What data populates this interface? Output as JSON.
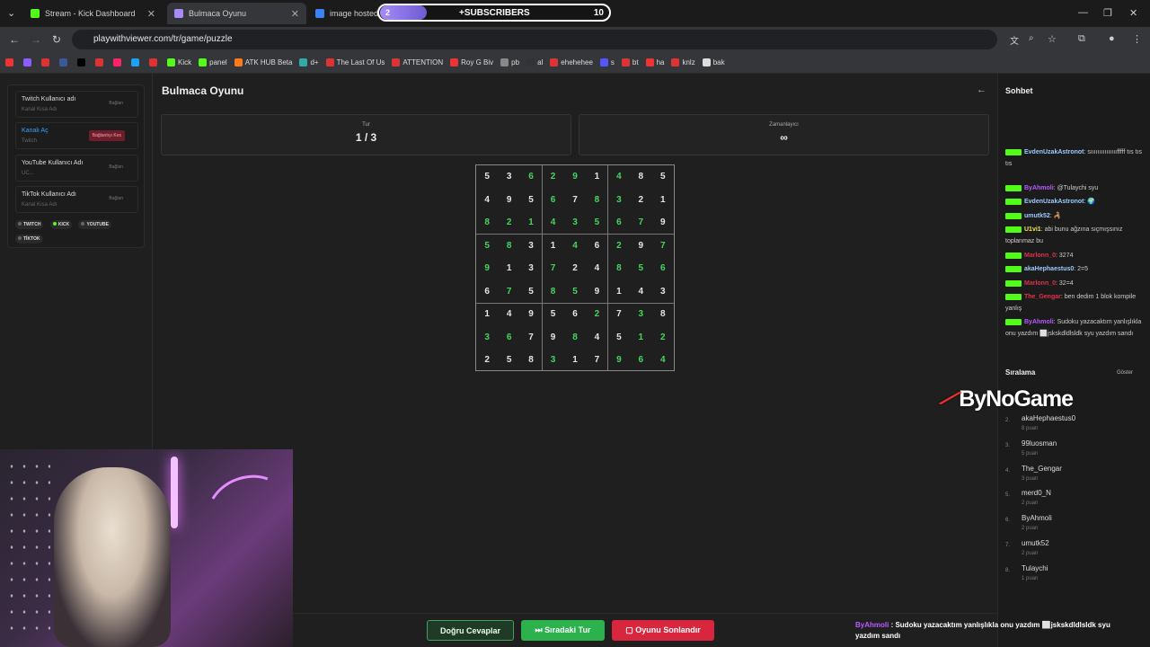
{
  "browser": {
    "tabs": [
      {
        "title": "Stream - Kick Dashboard",
        "favicon_color": "#53fc18"
      },
      {
        "title": "Bulmaca Oyunu",
        "favicon_color": "#a78bfa"
      },
      {
        "title": "image hosted a",
        "favicon_color": "#3b82f6"
      }
    ],
    "url": "playwithviewer.com/tr/game/puzzle",
    "bookmarks": [
      "Kick",
      "panel",
      "ATK HUB Beta",
      "d+",
      "The Last Of Us",
      "ATTENTION",
      "Roy G Biv",
      "pb",
      "al",
      "ehehehee",
      "s",
      "bt",
      "ha",
      "knlz",
      "bak"
    ]
  },
  "subscribers_widget": {
    "count_left": "2",
    "label": "+SUBSCRIBERS",
    "count_right": "10"
  },
  "left_panel": {
    "accounts": [
      {
        "name": "Twitch Kullanıcı adı",
        "sub": "Kanal Kısa Adı",
        "button": "Bağlan"
      },
      {
        "name": "Kanalı Aç",
        "sub": "Twitch",
        "button": "Bağlantıyı Kes"
      },
      {
        "name": "YouTube Kullanıcı Adı",
        "sub": "UC...",
        "button": "Bağlan"
      },
      {
        "name": "TikTok Kullanıcı Adı",
        "sub": "Kanal Kısa Adı",
        "button": "Bağlan"
      }
    ],
    "platforms": [
      "TWITCH",
      "KICK",
      "YOUTUBE",
      "TİKTOK"
    ]
  },
  "game": {
    "title": "Bulmaca Oyunu",
    "round_label": "Tur",
    "round_value": "1 / 3",
    "timer_label": "Zamanlayıcı",
    "timer_value": "∞",
    "grid": [
      [
        5,
        3,
        6,
        2,
        9,
        1,
        4,
        8,
        5
      ],
      [
        4,
        9,
        5,
        6,
        7,
        8,
        3,
        2,
        1
      ],
      [
        8,
        2,
        1,
        4,
        3,
        5,
        6,
        7,
        9
      ],
      [
        5,
        8,
        3,
        1,
        4,
        6,
        2,
        9,
        7
      ],
      [
        9,
        1,
        3,
        7,
        2,
        4,
        8,
        5,
        6
      ],
      [
        6,
        7,
        5,
        8,
        5,
        9,
        1,
        4,
        3
      ],
      [
        1,
        4,
        9,
        5,
        6,
        2,
        7,
        3,
        8
      ],
      [
        3,
        6,
        7,
        9,
        8,
        4,
        5,
        1,
        2
      ],
      [
        2,
        5,
        8,
        3,
        1,
        7,
        9,
        6,
        4
      ]
    ],
    "green_mask": [
      [
        0,
        0,
        1,
        1,
        1,
        0,
        1,
        0,
        0
      ],
      [
        0,
        0,
        0,
        1,
        0,
        1,
        1,
        0,
        0
      ],
      [
        1,
        1,
        1,
        1,
        1,
        1,
        1,
        1,
        0
      ],
      [
        1,
        1,
        0,
        0,
        1,
        0,
        1,
        0,
        1
      ],
      [
        1,
        0,
        0,
        1,
        0,
        0,
        1,
        1,
        1
      ],
      [
        0,
        1,
        0,
        1,
        1,
        0,
        0,
        0,
        0
      ],
      [
        0,
        0,
        0,
        0,
        0,
        1,
        0,
        1,
        0
      ],
      [
        1,
        1,
        0,
        0,
        1,
        0,
        0,
        1,
        1
      ],
      [
        0,
        0,
        0,
        1,
        0,
        0,
        1,
        1,
        1
      ]
    ],
    "colors": {
      "given": "#e5e5e5",
      "filled": "#45d55f"
    },
    "buttons": {
      "answers": "Doğru Cevaplar",
      "next": "Sıradaki Tur",
      "end": "Oyunu Sonlandır"
    }
  },
  "chat": {
    "title": "Sohbet",
    "messages": [
      {
        "user": "EvdenUzakAstronot",
        "color": "#9ecbff",
        "text": "sıııııııııııııııfffff tıs tıs tıs"
      },
      {
        "user": "ByAhmoli",
        "color": "#b85bff",
        "text": "@Tulaychi syu"
      },
      {
        "user": "EvdenUzakAstronot",
        "color": "#9ecbff",
        "text": "🌍"
      },
      {
        "user": "umutk52",
        "color": "#9ecbff",
        "text": "🦂"
      },
      {
        "user": "U1vi1",
        "color": "#f2e85c",
        "text": "abi bunu ağzına sıçmışsınız toplanmaz bu"
      },
      {
        "user": "Marlonn_0",
        "color": "#e0314b",
        "text": "3274"
      },
      {
        "user": "akaHephaestus0",
        "color": "#9ecbff",
        "text": "2=5"
      },
      {
        "user": "Marlonn_0",
        "color": "#e0314b",
        "text": "32=4"
      },
      {
        "user": "The_Gengar",
        "color": "#e0314b",
        "text": "ben dedim 1 blok kompile yanlış"
      },
      {
        "user": "ByAhmoli",
        "color": "#b85bff",
        "text": "Sudoku yazacaktım yanlışlıkla onu yazdım ⬜jsksk​dldlsldk syu yazdım sandı"
      }
    ]
  },
  "ranking": {
    "title": "Sıralama",
    "show": "Göster",
    "entries": [
      {
        "rank": "2.",
        "name": "akaHephaestus0",
        "points": "8 puan"
      },
      {
        "rank": "3.",
        "name": "99luosman",
        "points": "5 puan"
      },
      {
        "rank": "4.",
        "name": "The_Gengar",
        "points": "3 puan"
      },
      {
        "rank": "5.",
        "name": "merd0_N",
        "points": "2 puan"
      },
      {
        "rank": "6.",
        "name": "ByAhmoli",
        "points": "2 puan"
      },
      {
        "rank": "7.",
        "name": "umutk52",
        "points": "2 puan"
      },
      {
        "rank": "8.",
        "name": "Tulaychi",
        "points": "1 puan"
      }
    ]
  },
  "overlay": {
    "logo": "ByNoGame",
    "ticker_user": "ByAhmoli",
    "ticker_text": "Sudoku yazacaktım yanlışlıkla onu yazdım ⬜jsksk​dldlsldk syu yazdım sandı"
  }
}
